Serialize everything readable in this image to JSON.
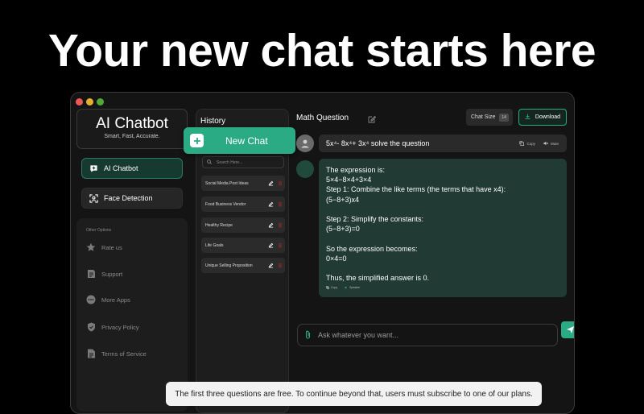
{
  "headline": "Your new chat starts here",
  "colors": {
    "accent": "#2bab84",
    "background": "#000000",
    "panel": "#1d1d1d",
    "answer_bubble": "#213a33"
  },
  "brand": {
    "title": "AI Chatbot",
    "subtitle": "Smart, Fast, Accurate."
  },
  "nav": [
    {
      "label": "AI Chatbot",
      "icon": "chat-plus-icon",
      "active": true
    },
    {
      "label": "Face Detection",
      "icon": "face-scan-icon",
      "active": false
    }
  ],
  "other": {
    "title": "Other Options",
    "items": [
      {
        "label": "Rate us",
        "icon": "star-icon"
      },
      {
        "label": "Support",
        "icon": "support-icon"
      },
      {
        "label": "More Apps",
        "icon": "more-icon"
      },
      {
        "label": "Privacy Policy",
        "icon": "shield-icon"
      },
      {
        "label": "Terms of Service",
        "icon": "document-icon"
      }
    ]
  },
  "history": {
    "title": "History",
    "search_placeholder": "Search Here...",
    "items": [
      "Social Media Post Ideas",
      "Food Business Vendor",
      "Healthy Recipe",
      "Life Goals",
      "Unique Selling Proposition"
    ]
  },
  "new_chat": {
    "label": "New Chat"
  },
  "chat": {
    "title": "Math Question",
    "chat_size_label": "Chat Size",
    "chat_size_value": "14",
    "download_label": "Download",
    "question": "5x⁴- 8x⁴+ 3x⁴ solve the question",
    "copy_label": "Copy",
    "mute_label": "Mute",
    "answer_lines": [
      "The expression is:",
      "5×4−8×4+3×4",
      "Step 1: Combine the like terms (the terms that have x4):",
      "(5−8+3)x4",
      "",
      "Step 2: Simplify the constants:",
      "(5−8+3)=0",
      "",
      "So the expression becomes:",
      "0×4=0",
      "",
      "Thus, the simplified answer is 0."
    ],
    "answer_copy_label": "Copy",
    "answer_speaker_label": "Speaker",
    "input_placeholder": "Ask whatever you want..."
  },
  "notice": "The first three questions are free. To continue beyond that, users must subscribe to one of our plans."
}
